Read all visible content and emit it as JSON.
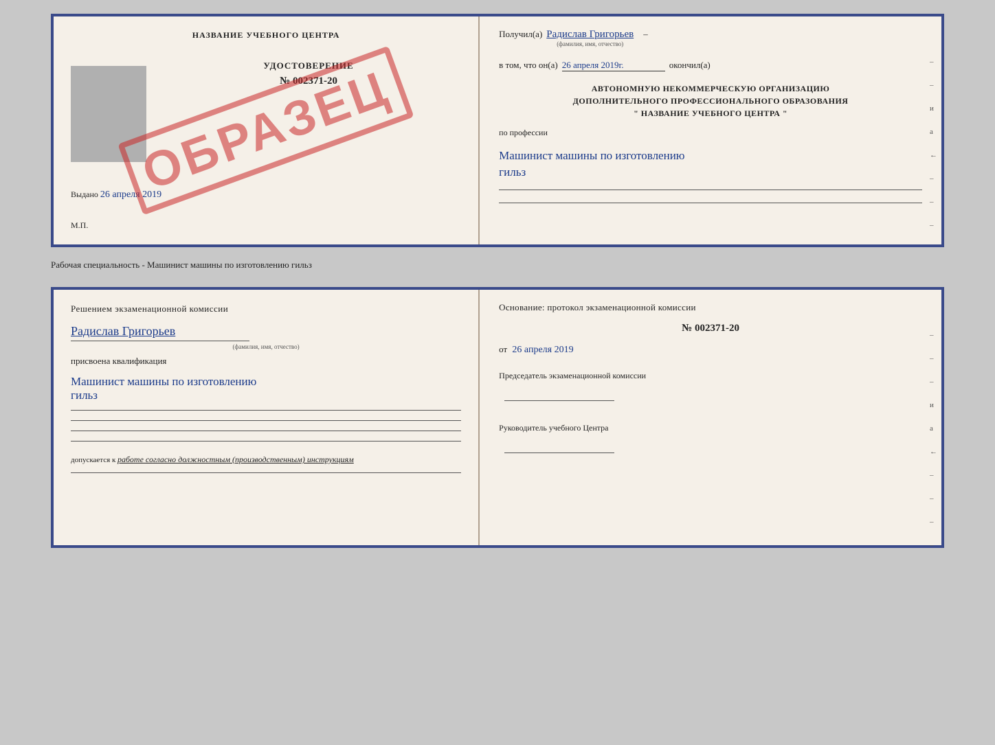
{
  "page": {
    "background": "#c8c8c8"
  },
  "subtitle": "Рабочая специальность - Машинист машины по изготовлению гильз",
  "top_doc": {
    "left": {
      "heading": "НАЗВАНИЕ УЧЕБНОГО ЦЕНТРА",
      "stamp_text": "ОБРАЗЕЦ",
      "cert_title": "УДОСТОВЕРЕНИЕ",
      "cert_number": "№ 002371-20",
      "issued_label": "Выдано",
      "issued_date": "26 апреля 2019",
      "mp_label": "М.П."
    },
    "right": {
      "poluchil_label": "Получил(а)",
      "poluchil_value": "Радислав Григорьев",
      "fio_note": "(фамилия, имя, отчество)",
      "vtom_label": "в том, что он(а)",
      "vtom_date": "26 апреля 2019г.",
      "okonchil_label": "окончил(а)",
      "org_line1": "АВТОНОМНУЮ НЕКОММЕРЧЕСКУЮ ОРГАНИЗАЦИЮ",
      "org_line2": "ДОПОЛНИТЕЛЬНОГО ПРОФЕССИОНАЛЬНОГО ОБРАЗОВАНИЯ",
      "org_line3": "\"   НАЗВАНИЕ УЧЕБНОГО ЦЕНТРА   \"",
      "po_professii": "по профессии",
      "profession": "Машинист машины по изготовлению",
      "profession2": "гильз",
      "side_marks": [
        "-",
        "-",
        "и",
        "а",
        "←",
        "-",
        "-",
        "-"
      ]
    }
  },
  "bottom_doc": {
    "left": {
      "heading": "Решением  экзаменационной  комиссии",
      "fio_value": "Радислав Григорьев",
      "fio_note": "(фамилия, имя, отчество)",
      "prisvoena": "присвоена квалификация",
      "kvalif": "Машинист  машины  по  изготовлению",
      "kvalif2": "гильз",
      "dopuskaetsya": "допускается к",
      "dopusk_value": "работе согласно должностным (производственным) инструкциям"
    },
    "right": {
      "osnov_label": "Основание: протокол экзаменационной  комиссии",
      "number": "№  002371-20",
      "ot_label": "от",
      "ot_date": "26 апреля 2019",
      "pred_label": "Председатель экзаменационной комиссии",
      "ruk_label": "Руководитель учебного Центра",
      "side_marks": [
        "-",
        "-",
        "-",
        "и",
        "а",
        "←",
        "-",
        "-",
        "-",
        "-"
      ]
    }
  }
}
